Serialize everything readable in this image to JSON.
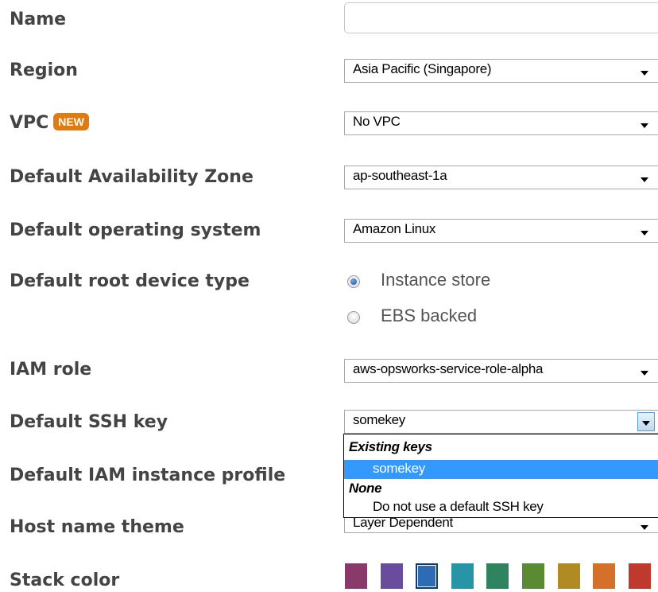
{
  "fields": {
    "name": {
      "label": "Name",
      "value": ""
    },
    "region": {
      "label": "Region",
      "value": "Asia Pacific (Singapore)"
    },
    "vpc": {
      "label": "VPC",
      "badge": "NEW",
      "value": "No VPC"
    },
    "availability_zone": {
      "label": "Default Availability Zone",
      "value": "ap-southeast-1a"
    },
    "operating_system": {
      "label": "Default operating system",
      "value": "Amazon Linux"
    },
    "root_device": {
      "label": "Default root device type",
      "options": [
        "Instance store",
        "EBS backed"
      ],
      "selected": "Instance store"
    },
    "iam_role": {
      "label": "IAM role",
      "value": "aws-opsworks-service-role-alpha"
    },
    "ssh_key": {
      "label": "Default SSH key",
      "value": "somekey"
    },
    "instance_profile": {
      "label": "Default IAM instance profile"
    },
    "host_name_theme": {
      "label": "Host name theme",
      "value": "Layer Dependent"
    },
    "stack_color": {
      "label": "Stack color",
      "colors": [
        "#8a3a6a",
        "#6a4c9c",
        "#2d6cb5",
        "#2795a6",
        "#2f8460",
        "#5a8a32",
        "#b08a22",
        "#d4702a",
        "#c0392f"
      ],
      "selected_index": 2
    }
  },
  "ssh_dropdown": {
    "group_existing": "Existing keys",
    "existing_option": "somekey",
    "group_none": "None",
    "none_option": "Do not use a default SSH key"
  },
  "icons": {
    "select_arrow": "chevron-down-icon",
    "radio": "radio-icon"
  }
}
